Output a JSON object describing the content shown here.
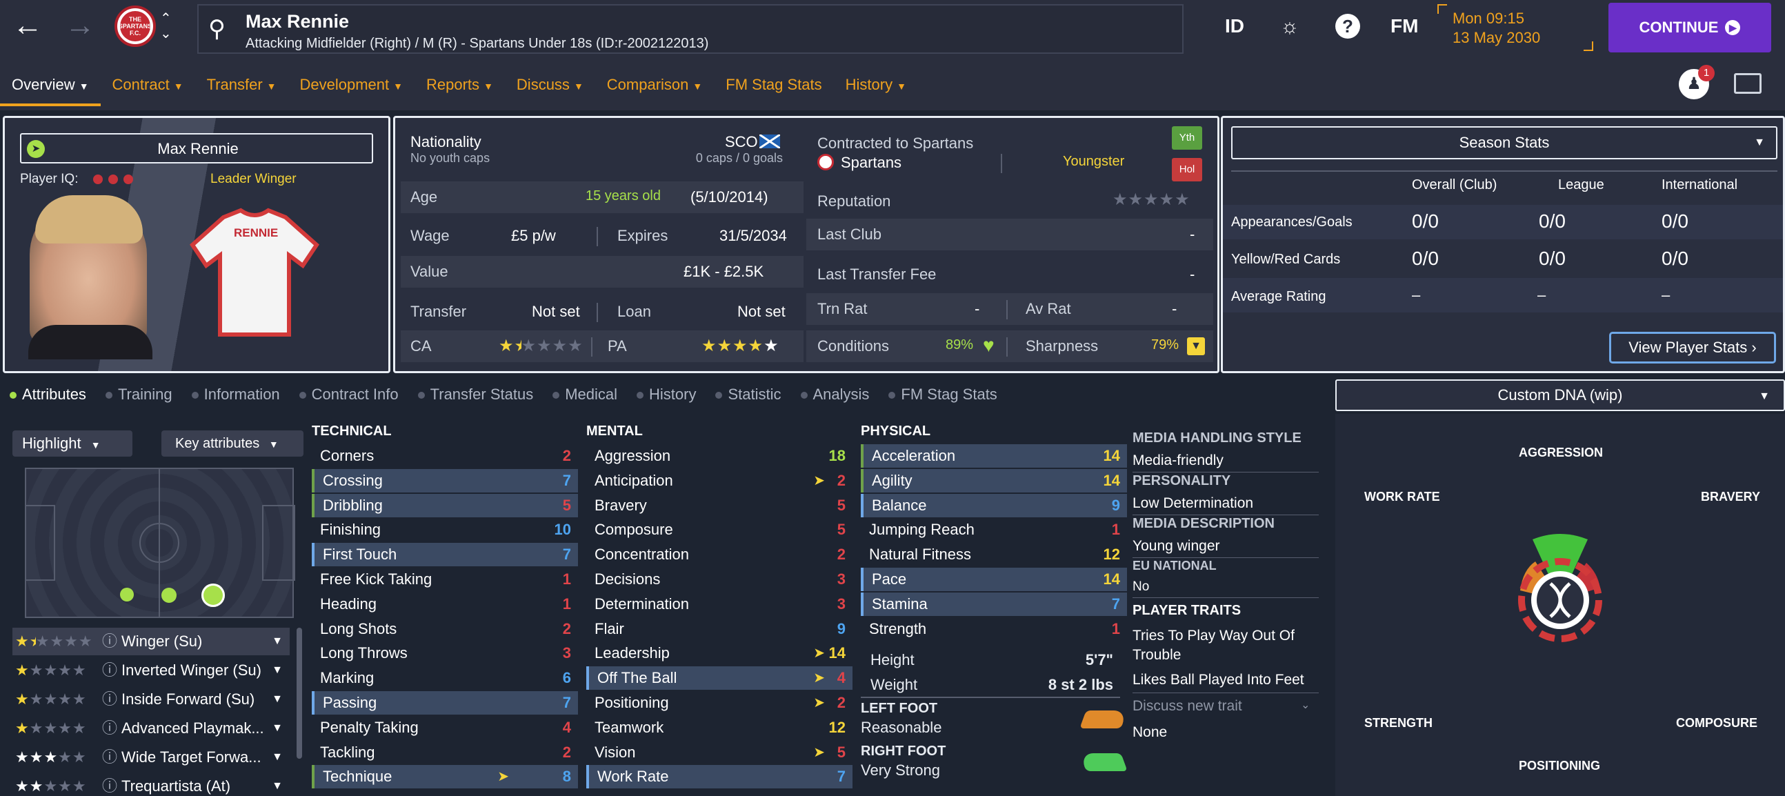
{
  "header": {
    "player_name": "Max Rennie",
    "player_subtitle": "Attacking Midfielder (Right) / M (R) - Spartans Under 18s (ID:r-2002122013)",
    "club_badge_text": "THE SPARTANS F.C.",
    "icons": [
      "back-arrow-icon",
      "forward-arrow-icon",
      "search-icon",
      "id-icon",
      "brain-icon",
      "help-icon",
      "fm-icon",
      "notification-icon",
      "monitor-icon"
    ],
    "id_label": "ID",
    "help_label": "?",
    "fm_label": "FM",
    "date_line1": "Mon 09:15",
    "date_line2": "13 May 2030",
    "continue_label": "CONTINUE",
    "notification_count": "1",
    "accent_color": "#f0a21e",
    "continue_color": "#6a2fc8"
  },
  "tabs": [
    "Overview",
    "Contract",
    "Transfer",
    "Development",
    "Reports",
    "Discuss",
    "Comparison",
    "FM Stag Stats",
    "History"
  ],
  "profile": {
    "name": "Max Rennie",
    "iq_label": "Player IQ:",
    "role_tag": "Leader  Winger",
    "shirt_name": "RENNIE"
  },
  "info": {
    "nationality_label": "Nationality",
    "youth_caps": "No youth caps",
    "nation_code": "SCO",
    "caps_goals": "0 caps / 0 goals",
    "contracted_label": "Contracted to Spartans",
    "club_name": "Spartans",
    "youngster_label": "Youngster",
    "yth_badge": "Yth",
    "hol_badge": "Hol",
    "age_label": "Age",
    "age_value": "15 years old",
    "dob": "(5/10/2014)",
    "reputation_label": "Reputation",
    "wage_label": "Wage",
    "wage_value": "£5 p/w",
    "expires_label": "Expires",
    "expires_value": "31/5/2034",
    "last_club_label": "Last Club",
    "last_club_value": "-",
    "value_label": "Value",
    "value_value": "£1K - £2.5K",
    "last_fee_label": "Last Transfer Fee",
    "last_fee_value": "-",
    "transfer_label": "Transfer",
    "transfer_value": "Not set",
    "loan_label": "Loan",
    "loan_value": "Not set",
    "trn_rat_label": "Trn Rat",
    "trn_rat_value": "-",
    "av_rat_label": "Av Rat",
    "av_rat_value": "-",
    "ca_label": "CA",
    "ca_stars": 1.5,
    "pa_label": "PA",
    "pa_stars": 4.5,
    "conditions_label": "Conditions",
    "conditions_value": "89%",
    "sharpness_label": "Sharpness",
    "sharpness_value": "79%"
  },
  "season": {
    "title": "Season Stats",
    "cols": [
      "Overall (Club)",
      "League",
      "International"
    ],
    "rows": [
      {
        "label": "Appearances/Goals",
        "values": [
          "0/0",
          "0/0",
          "0/0"
        ]
      },
      {
        "label": "Yellow/Red Cards",
        "values": [
          "0/0",
          "0/0",
          "0/0"
        ]
      },
      {
        "label": "Average Rating",
        "values": [
          "–",
          "–",
          "–"
        ]
      }
    ],
    "view_button": "View Player Stats"
  },
  "subtabs": [
    "Attributes",
    "Training",
    "Information",
    "Contract Info",
    "Transfer Status",
    "Medical",
    "History",
    "Statistic",
    "Analysis",
    "FM Stag Stats"
  ],
  "dna_dropdown": "Custom DNA (wip)",
  "left": {
    "highlight": "Highlight",
    "key_attributes": "Key attributes",
    "roles": [
      {
        "name": "Winger (Su)",
        "stars": 1.5
      },
      {
        "name": "Inverted Winger (Su)",
        "stars": 1
      },
      {
        "name": "Inside Forward (Su)",
        "stars": 1
      },
      {
        "name": "Advanced Playmak...",
        "stars": 1
      },
      {
        "name": "Wide Target Forwa...",
        "stars": 3
      },
      {
        "name": "Trequartista (At)",
        "stars": 2
      }
    ]
  },
  "attributes": {
    "technical_title": "TECHNICAL",
    "mental_title": "MENTAL",
    "physical_title": "PHYSICAL",
    "technical": [
      {
        "name": "Corners",
        "value": "2"
      },
      {
        "name": "Crossing",
        "value": "7"
      },
      {
        "name": "Dribbling",
        "value": "5"
      },
      {
        "name": "Finishing",
        "value": "10"
      },
      {
        "name": "First Touch",
        "value": "7"
      },
      {
        "name": "Free Kick Taking",
        "value": "1"
      },
      {
        "name": "Heading",
        "value": "1"
      },
      {
        "name": "Long Shots",
        "value": "2"
      },
      {
        "name": "Long Throws",
        "value": "3"
      },
      {
        "name": "Marking",
        "value": "6"
      },
      {
        "name": "Passing",
        "value": "7"
      },
      {
        "name": "Penalty Taking",
        "value": "4"
      },
      {
        "name": "Tackling",
        "value": "2"
      },
      {
        "name": "Technique",
        "value": "8"
      }
    ],
    "mental": [
      {
        "name": "Aggression",
        "value": "18"
      },
      {
        "name": "Anticipation",
        "value": "2"
      },
      {
        "name": "Bravery",
        "value": "5"
      },
      {
        "name": "Composure",
        "value": "5"
      },
      {
        "name": "Concentration",
        "value": "2"
      },
      {
        "name": "Decisions",
        "value": "3"
      },
      {
        "name": "Determination",
        "value": "3"
      },
      {
        "name": "Flair",
        "value": "9"
      },
      {
        "name": "Leadership",
        "value": "14"
      },
      {
        "name": "Off The Ball",
        "value": "4"
      },
      {
        "name": "Positioning",
        "value": "2"
      },
      {
        "name": "Teamwork",
        "value": "12"
      },
      {
        "name": "Vision",
        "value": "5"
      },
      {
        "name": "Work Rate",
        "value": "7"
      }
    ],
    "physical": [
      {
        "name": "Acceleration",
        "value": "14"
      },
      {
        "name": "Agility",
        "value": "14"
      },
      {
        "name": "Balance",
        "value": "9"
      },
      {
        "name": "Jumping Reach",
        "value": "1"
      },
      {
        "name": "Natural Fitness",
        "value": "12"
      },
      {
        "name": "Pace",
        "value": "14"
      },
      {
        "name": "Stamina",
        "value": "7"
      },
      {
        "name": "Strength",
        "value": "1"
      }
    ],
    "height_label": "Height",
    "height_value": "5'7\"",
    "weight_label": "Weight",
    "weight_value": "8 st 2 lbs",
    "left_foot_label": "LEFT FOOT",
    "left_foot_value": "Reasonable",
    "right_foot_label": "RIGHT FOOT",
    "right_foot_value": "Very Strong"
  },
  "media": {
    "style_label": "MEDIA HANDLING STYLE",
    "style_value": "Media-friendly",
    "personality_label": "PERSONALITY",
    "personality_value": "Low Determination",
    "description_label": "MEDIA DESCRIPTION",
    "description_value": "Young winger",
    "eu_label": "EU NATIONAL",
    "eu_value": "No",
    "traits_label": "PLAYER TRAITS",
    "trait1": "Tries To Play Way Out Of",
    "trait1b": "Trouble",
    "trait2": "Likes Ball Played Into Feet",
    "discuss_trait": "Discuss new trait",
    "none_label": "None"
  },
  "dna": {
    "aggression": "AGGRESSION",
    "work_rate": "WORK RATE",
    "bravery": "BRAVERY",
    "strength": "STRENGTH",
    "composure": "COMPOSURE",
    "positioning": "POSITIONING"
  }
}
